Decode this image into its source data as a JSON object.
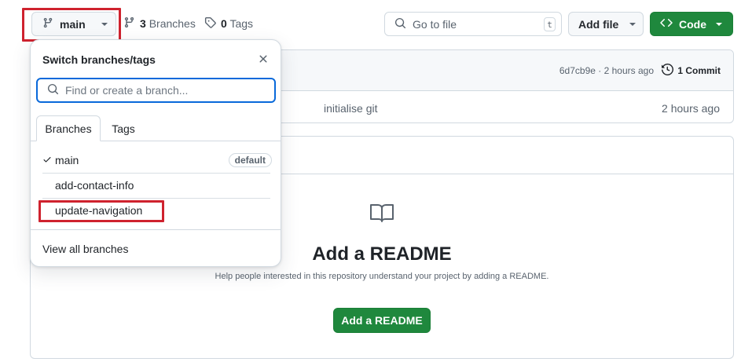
{
  "toolbar": {
    "branch_label": "main",
    "branches_count": "3",
    "branches_label": "Branches",
    "tags_count": "0",
    "tags_label": "Tags",
    "search_placeholder": "Go to file",
    "search_shortcut": "t",
    "add_file_label": "Add file",
    "code_label": "Code"
  },
  "commit": {
    "hash": "6d7cb9e",
    "separator": "·",
    "time": "2 hours ago",
    "count_label": "1 Commit",
    "file_message": "initialise git",
    "file_time": "2 hours ago"
  },
  "readme": {
    "title": "Add a README",
    "subtitle": "Help people interested in this repository understand your project by adding a README.",
    "button_label": "Add a README"
  },
  "dropdown": {
    "title": "Switch branches/tags",
    "input_placeholder": "Find or create a branch...",
    "tabs": [
      {
        "label": "Branches",
        "active": true
      },
      {
        "label": "Tags",
        "active": false
      }
    ],
    "branches": [
      {
        "name": "main",
        "checked": true,
        "badge": "default"
      },
      {
        "name": "add-contact-info",
        "checked": false,
        "badge": ""
      },
      {
        "name": "update-navigation",
        "checked": false,
        "badge": ""
      }
    ],
    "view_all_label": "View all branches"
  },
  "colors": {
    "primary_green": "#1f883d",
    "focus_blue": "#0969da",
    "highlight_red": "#cf222e"
  },
  "icons": [
    "branch-icon",
    "caret-down-icon",
    "tag-icon",
    "search-icon",
    "code-icon",
    "history-icon",
    "book-icon",
    "close-icon",
    "check-icon"
  ]
}
